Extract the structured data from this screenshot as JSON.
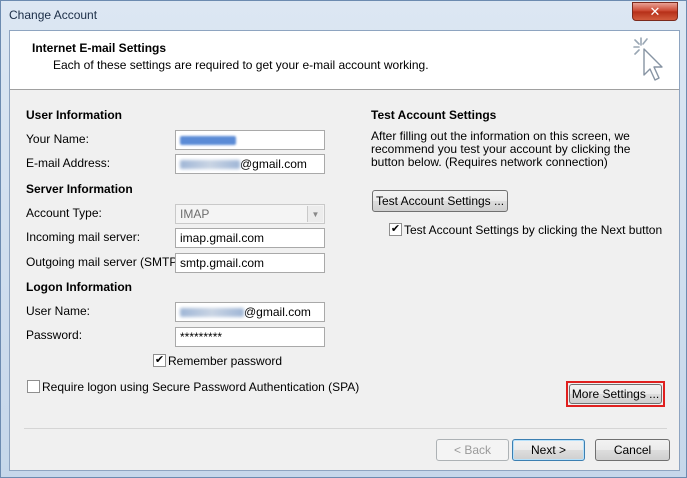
{
  "window": {
    "title": "Change Account",
    "close_glyph": "✕"
  },
  "header": {
    "title": "Internet E-mail Settings",
    "subtitle": "Each of these settings are required to get your e-mail account working."
  },
  "user_info": {
    "title": "User Information",
    "name_label": "Your Name:",
    "email_label": "E-mail Address:",
    "email_suffix": "@gmail.com"
  },
  "server_info": {
    "title": "Server Information",
    "account_type_label": "Account Type:",
    "account_type_value": "IMAP",
    "incoming_label": "Incoming mail server:",
    "incoming_value": "imap.gmail.com",
    "outgoing_label": "Outgoing mail server (SMTP):",
    "outgoing_value": "smtp.gmail.com"
  },
  "logon_info": {
    "title": "Logon Information",
    "username_label": "User Name:",
    "username_suffix": "@gmail.com",
    "password_label": "Password:",
    "password_value": "*********",
    "remember_label": "Remember password",
    "remember_checked": true,
    "spa_label": "Require logon using Secure Password Authentication (SPA)",
    "spa_checked": false
  },
  "test": {
    "title": "Test Account Settings",
    "description": "After filling out the information on this screen, we recommend you test your account by clicking the button below. (Requires network connection)",
    "button_label": "Test Account Settings ...",
    "next_check_label": "Test Account Settings by clicking the Next button",
    "next_check_checked": true
  },
  "buttons": {
    "more_settings": "More Settings ...",
    "back": "< Back",
    "next": "Next >",
    "cancel": "Cancel"
  },
  "colors": {
    "highlight": "#e0201f",
    "accent": "#3c7fb1"
  }
}
